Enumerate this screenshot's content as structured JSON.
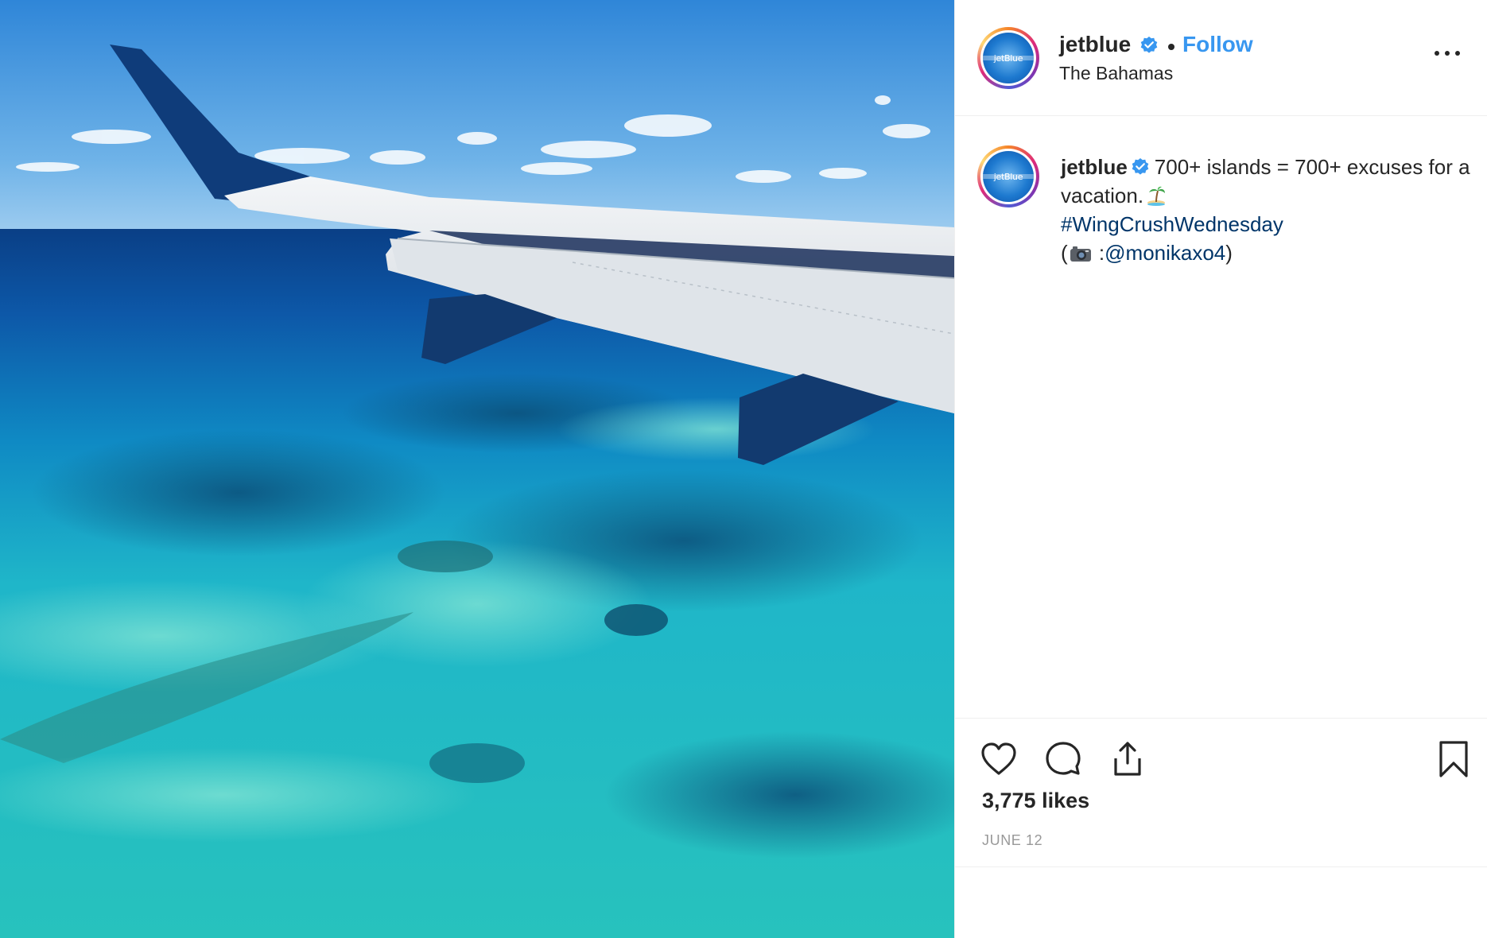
{
  "post": {
    "username": "jetblue",
    "follow_label": "Follow",
    "location": "The Bahamas",
    "avatar_logo_text": "jetBlue",
    "caption": {
      "username": "jetblue",
      "text_line1": "700+ islands = 700+ excuses for a vacation.",
      "hashtag": "#WingCrushWednesday",
      "credit_open": "(",
      "credit_colon": ":",
      "credit_handle": "@monikaxo4",
      "credit_close": ")"
    },
    "likes": "3,775 likes",
    "date": "JUNE 12"
  },
  "icons": {
    "verified": "verified-badge-icon",
    "more": "more-options-icon",
    "palm": "palm-island-emoji-icon",
    "camera": "camera-emoji-icon",
    "like": "heart-icon",
    "comment": "comment-icon",
    "share": "share-icon",
    "save": "bookmark-icon"
  },
  "colors": {
    "link_blue": "#3897f0",
    "hashtag": "#003569",
    "text": "#262626",
    "muted": "#999999",
    "border": "#efefef"
  }
}
